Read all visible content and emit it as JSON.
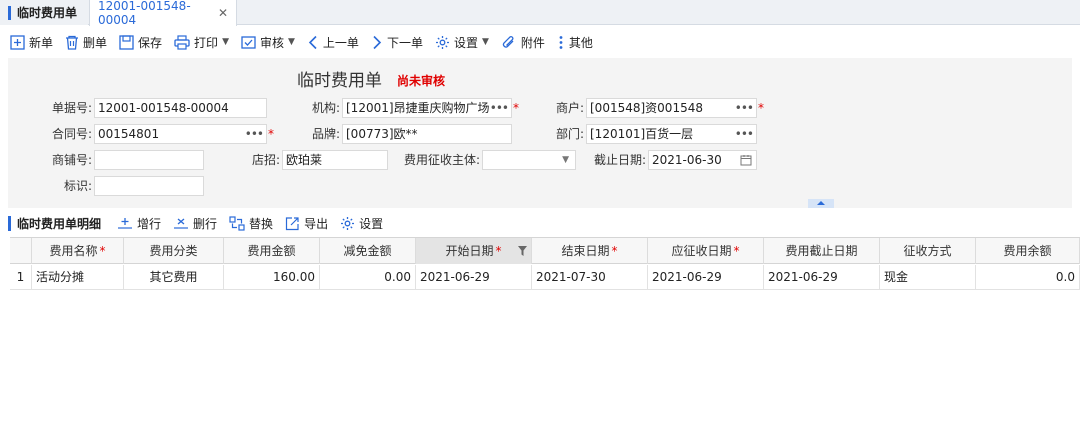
{
  "tabs": [
    {
      "label": "临时费用单"
    },
    {
      "label": "12001-001548-00004",
      "close": "✕"
    }
  ],
  "toolbar": {
    "new": "新单",
    "delete": "删单",
    "save": "保存",
    "print": "打印",
    "review": "审核",
    "prev": "上一单",
    "next": "下一单",
    "settings": "设置",
    "attach": "附件",
    "more": "其他"
  },
  "form": {
    "title": "临时费用单",
    "status": "尚未审核",
    "doc_no": {
      "label": "单据号:",
      "value": "12001-001548-00004"
    },
    "org": {
      "label": "机构:",
      "value": "[12001]昂捷重庆购物广场"
    },
    "merchant": {
      "label": "商户:",
      "value": "[001548]资001548"
    },
    "contract": {
      "label": "合同号:",
      "value": "00154801"
    },
    "brand": {
      "label": "品牌:",
      "value": "[00773]欧**"
    },
    "dept": {
      "label": "部门:",
      "value": "[120101]百货一层"
    },
    "shop_no": {
      "label": "商铺号:",
      "value": ""
    },
    "sign": {
      "label": "店招:",
      "value": "欧珀莱"
    },
    "fee_subject": {
      "label": "费用征收主体:",
      "value": ""
    },
    "deadline": {
      "label": "截止日期:",
      "value": "2021-06-30"
    },
    "tag": {
      "label": "标识:",
      "value": ""
    },
    "dots": "•••",
    "required": "*"
  },
  "detail": {
    "title": "临时费用单明细",
    "add_row": "增行",
    "del_row": "删行",
    "replace": "替换",
    "export": "导出",
    "settings": "设置"
  },
  "grid": {
    "columns": [
      "费用名称",
      "费用分类",
      "费用金额",
      "减免金额",
      "开始日期",
      "结束日期",
      "应征收日期",
      "费用截止日期",
      "征收方式",
      "费用余额"
    ],
    "required_mark": "*",
    "rows": [
      {
        "idx": "1",
        "name": "活动分摊",
        "category": "其它费用",
        "amount": "160.00",
        "discount": "0.00",
        "start": "2021-06-29",
        "end": "2021-07-30",
        "due": "2021-06-29",
        "cutoff": "2021-06-29",
        "method": "现金",
        "balance": "0.0"
      }
    ]
  }
}
